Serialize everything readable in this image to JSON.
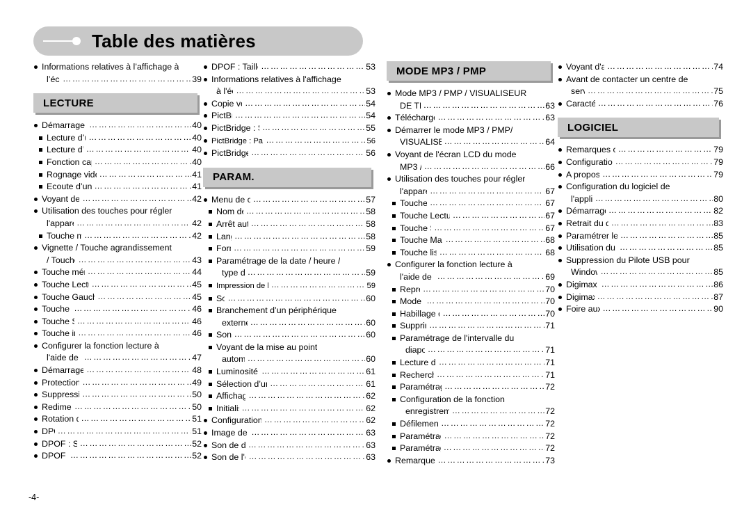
{
  "document": {
    "title": "Table des matières",
    "page_number": "-4-",
    "leader_dots": "……………………………………………………………………"
  },
  "theme": {
    "banner_bg": "#c8c8c8",
    "section_bg": "#c8c8c8",
    "section_shadow": "#9a9a9a",
    "text": "#000000",
    "page_bg": "#ffffff"
  },
  "columns": [
    {
      "name": "column-1",
      "blocks": [
        {
          "type": "entries",
          "items": [
            {
              "level": "main",
              "text": "Informations relatives à l’affichage à",
              "page": "",
              "leader": false
            },
            {
              "level": "cont",
              "text": "l’écran",
              "page": "39",
              "leader": true
            }
          ]
        },
        {
          "type": "section",
          "label": "LECTURE"
        },
        {
          "type": "entries",
          "items": [
            {
              "level": "main",
              "text": "Démarrage du mode lecture",
              "page": "40",
              "leader": true
            },
            {
              "level": "sub",
              "text": "Lecture d’une image fixe",
              "page": "40",
              "leader": true
            },
            {
              "level": "sub",
              "text": "Lecture d’un clip vidéo",
              "page": "40",
              "leader": true
            },
            {
              "level": "sub",
              "text": "Fonction capture de clip vidéo",
              "page": "40",
              "leader": true
            },
            {
              "level": "sub",
              "text": "Rognage vidéo sur l'appareil photo",
              "page": "41",
              "leader": true
            },
            {
              "level": "sub",
              "text": "Ecoute d’une voix enregistrée",
              "page": "41",
              "leader": true
            },
            {
              "level": "main",
              "text": "Voyant de l'écran LCD",
              "page": "42",
              "leader": true
            },
            {
              "level": "main",
              "text": "Utilisation des touches pour régler",
              "page": "",
              "leader": false
            },
            {
              "level": "cont",
              "text": "l'appareil photo",
              "page": "42",
              "leader": true
            },
            {
              "level": "sub",
              "text": "Touche mode lecture",
              "page": "42",
              "leader": true
            },
            {
              "level": "main",
              "text": "Vignette / Touche agrandissement",
              "page": "",
              "leader": false
            },
            {
              "level": "cont",
              "text": "/ Touche volume",
              "page": "43",
              "leader": true
            },
            {
              "level": "main",
              "text": "Touche mémo vocal / Haut",
              "page": "44",
              "leader": true
            },
            {
              "level": "main",
              "text": "Touche Lecture & Pause / Bas",
              "page": "45",
              "leader": true
            },
            {
              "level": "main",
              "text": "Touche Gauche / Droite / Menu / OK",
              "page": "45",
              "leader": true
            },
            {
              "level": "main",
              "text": "Touche E (Effet)",
              "page": "46",
              "leader": true
            },
            {
              "level": "main",
              "text": "Touche Supprimer",
              "page": "46",
              "leader": true
            },
            {
              "level": "main",
              "text": "Touche imprimante",
              "page": "46",
              "leader": true
            },
            {
              "level": "main",
              "text": "Configurer la fonction lecture à",
              "page": "",
              "leader": false
            },
            {
              "level": "cont",
              "text": "l'aide de l'écran LCD",
              "page": "47",
              "leader": true
            },
            {
              "level": "main",
              "text": "Démarrage du diaporama",
              "page": "48",
              "leader": true
            },
            {
              "level": "main",
              "text": "Protection des images",
              "page": "49",
              "leader": true
            },
            {
              "level": "main",
              "text": "Suppression d’images",
              "page": "50",
              "leader": true
            },
            {
              "level": "main",
              "text": "Redimensionner",
              "page": "50",
              "leader": true
            },
            {
              "level": "main",
              "text": "Rotation d’une image",
              "page": "51",
              "leader": true
            },
            {
              "level": "main",
              "text": "DPOF",
              "page": "51",
              "leader": true
            },
            {
              "level": "main",
              "text": "DPOF : STANDARD",
              "page": "52",
              "leader": true
            },
            {
              "level": "main",
              "text": "DPOF : Index",
              "page": "52",
              "leader": true
            }
          ]
        }
      ]
    },
    {
      "name": "column-2",
      "blocks": [
        {
          "type": "entries",
          "items": [
            {
              "level": "main",
              "text": "DPOF : Taille de l'impression",
              "page": "53",
              "leader": true
            },
            {
              "level": "main",
              "text": "Informations relatives à l'affichage",
              "page": "",
              "leader": false
            },
            {
              "level": "cont",
              "text": "à l'écran",
              "page": "53",
              "leader": true
            },
            {
              "level": "main",
              "text": "Copie vers carte",
              "page": "54",
              "leader": true
            },
            {
              "level": "main",
              "text": "PictBridge",
              "page": "54",
              "leader": true
            },
            {
              "level": "main",
              "text": "PictBridge : Sélection d’image",
              "page": "55",
              "leader": true
            },
            {
              "level": "main",
              "text": "PictBridge : Paramétrage impression",
              "page": "56",
              "leader": true,
              "narrow": true
            },
            {
              "level": "main",
              "text": "PictBridge : REMISE",
              "page": "56",
              "leader": true
            }
          ]
        },
        {
          "type": "section",
          "label": "PARAM."
        },
        {
          "type": "entries",
          "items": [
            {
              "level": "main",
              "text": "Menu de configuration",
              "page": "57",
              "leader": true
            },
            {
              "level": "sub",
              "text": "Nom de fichier",
              "page": "58",
              "leader": true
            },
            {
              "level": "sub",
              "text": "Arrêt automatique",
              "page": "58",
              "leader": true
            },
            {
              "level": "sub",
              "text": "Langue",
              "page": "58",
              "leader": true
            },
            {
              "level": "sub",
              "text": "Format",
              "page": "59",
              "leader": true
            },
            {
              "level": "sub",
              "text": "Paramétrage de la date / heure /",
              "page": "",
              "leader": false
            },
            {
              "level": "subcont",
              "text": "type de date",
              "page": "59",
              "leader": true
            },
            {
              "level": "sub",
              "text": "Impression de la date d’enregistrement",
              "page": "59",
              "leader": true,
              "narrow": true
            },
            {
              "level": "sub",
              "text": "Son",
              "page": "60",
              "leader": true
            },
            {
              "level": "sub",
              "text": "Branchement d’un périphérique",
              "page": "",
              "leader": false
            },
            {
              "level": "subcont",
              "text": "externe (USB)",
              "page": "60",
              "leader": true
            },
            {
              "level": "sub",
              "text": "Son AF",
              "page": "60",
              "leader": true
            },
            {
              "level": "sub",
              "text": "Voyant de la mise au point",
              "page": "",
              "leader": false
            },
            {
              "level": "subcont",
              "text": "automatique",
              "page": "60",
              "leader": true
            },
            {
              "level": "sub",
              "text": "Luminosité de l'écran LCD",
              "page": "61",
              "leader": true
            },
            {
              "level": "sub",
              "text": "Sélection d’un type de sortie vidéo",
              "page": "61",
              "leader": true
            },
            {
              "level": "sub",
              "text": "Affichage rapide",
              "page": "62",
              "leader": true
            },
            {
              "level": "sub",
              "text": "Initialisation",
              "page": "62",
              "leader": true
            },
            {
              "level": "main",
              "text": "Configuration du menu MYCAM",
              "page": "62",
              "leader": true
            },
            {
              "level": "main",
              "text": "Image de démarrage",
              "page": "63",
              "leader": true
            },
            {
              "level": "main",
              "text": "Son de démarrage",
              "page": "63",
              "leader": true
            },
            {
              "level": "main",
              "text": "Son de l'obturateur",
              "page": "63",
              "leader": true
            }
          ]
        }
      ]
    },
    {
      "name": "column-3",
      "blocks": [
        {
          "type": "section",
          "label": "MODE MP3 / PMP",
          "first": true
        },
        {
          "type": "entries",
          "items": [
            {
              "level": "main",
              "text": "Mode MP3 / PMP / VISUALISEUR",
              "page": "",
              "leader": false
            },
            {
              "level": "cont",
              "text": "DE TEXTE",
              "page": "63",
              "leader": true
            },
            {
              "level": "main",
              "text": "Télécharger des fichiers",
              "page": "63",
              "leader": true
            },
            {
              "level": "main",
              "text": "Démarrer le mode MP3 / PMP/",
              "page": "",
              "leader": false
            },
            {
              "level": "cont",
              "text": "VISUALISEUR DE TEXTE",
              "page": "64",
              "leader": true
            },
            {
              "level": "main",
              "text": "Voyant de l'écran LCD du mode",
              "page": "",
              "leader": false
            },
            {
              "level": "cont",
              "text": "MP3 / PMP",
              "page": "66",
              "leader": true
            },
            {
              "level": "main",
              "text": "Utilisation des touches pour régler",
              "page": "",
              "leader": false
            },
            {
              "level": "cont",
              "text": "l'appareil photo",
              "page": "67",
              "leader": true
            },
            {
              "level": "sub",
              "text": "Touche volume",
              "page": "67",
              "leader": true
            },
            {
              "level": "sub",
              "text": "Touche Lecture & Pause / Contrôle",
              "page": "67",
              "leader": true
            },
            {
              "level": "sub",
              "text": "Touche Supprimer",
              "page": "67",
              "leader": true
            },
            {
              "level": "sub",
              "text": "Touche Maintien / Egaliseur",
              "page": "68",
              "leader": true
            },
            {
              "level": "sub",
              "text": "Touche liste de lecture",
              "page": "68",
              "leader": true
            },
            {
              "level": "main",
              "text": "Configurer la fonction lecture à",
              "page": "",
              "leader": false
            },
            {
              "level": "cont",
              "text": "l'aide de l'écran LCD",
              "page": "69",
              "leader": true
            },
            {
              "level": "sub",
              "text": "Reprendre",
              "page": "70",
              "leader": true
            },
            {
              "level": "sub",
              "text": "Mode lecture",
              "page": "70",
              "leader": true
            },
            {
              "level": "sub",
              "text": "Habillage du lecteur MP3",
              "page": "70",
              "leader": true
            },
            {
              "level": "sub",
              "text": "Supprimer tout",
              "page": "71",
              "leader": true
            },
            {
              "level": "sub",
              "text": "Paramétrage de l'intervalle du",
              "page": "",
              "leader": false
            },
            {
              "level": "subcont",
              "text": "diaporama",
              "page": "71",
              "leader": true
            },
            {
              "level": "sub",
              "text": "Lecture du diaporama",
              "page": "71",
              "leader": true
            },
            {
              "level": "sub",
              "text": "Recherche de cadre",
              "page": "71",
              "leader": true
            },
            {
              "level": "sub",
              "text": "Paramétrage de l'affichage",
              "page": "72",
              "leader": true
            },
            {
              "level": "sub",
              "text": "Configuration de la fonction",
              "page": "",
              "leader": false
            },
            {
              "level": "subcont",
              "text": "enregistrement en mode MP3.",
              "page": "72",
              "leader": true
            },
            {
              "level": "sub",
              "text": "Défilement automatique",
              "page": "72",
              "leader": true
            },
            {
              "level": "sub",
              "text": "Paramétrage du fond MP3",
              "page": "72",
              "leader": true
            },
            {
              "level": "sub",
              "text": "Paramétrage de la langue",
              "page": "72",
              "leader": true
            },
            {
              "level": "main",
              "text": "Remarques importantes",
              "page": "73",
              "leader": true
            }
          ]
        }
      ]
    },
    {
      "name": "column-4",
      "blocks": [
        {
          "type": "entries",
          "items": [
            {
              "level": "main",
              "text": "Voyant d'avertissement",
              "page": "74",
              "leader": true
            },
            {
              "level": "main",
              "text": "Avant de contacter un centre de",
              "page": "",
              "leader": false
            },
            {
              "level": "cont",
              "text": "service",
              "page": "75",
              "leader": true
            },
            {
              "level": "main",
              "text": "Caractéristiques",
              "page": "76",
              "leader": true
            }
          ]
        },
        {
          "type": "section",
          "label": "LOGICIEL"
        },
        {
          "type": "entries",
          "items": [
            {
              "level": "main",
              "text": "Remarques concernant le logiciel",
              "page": "79",
              "leader": true
            },
            {
              "level": "main",
              "text": "Configuration système requise",
              "page": "79",
              "leader": true
            },
            {
              "level": "main",
              "text": "A propos du logiciel",
              "page": "79",
              "leader": true
            },
            {
              "level": "main",
              "text": "Configuration du logiciel de",
              "page": "",
              "leader": false
            },
            {
              "level": "cont",
              "text": "l'application",
              "page": "80",
              "leader": true
            },
            {
              "level": "main",
              "text": "Démarrage du mode PC",
              "page": "82",
              "leader": true
            },
            {
              "level": "main",
              "text": "Retrait du disque amovible",
              "page": "83",
              "leader": true
            },
            {
              "level": "main",
              "text": "Paramétrer le pilote USB pour MAC",
              "page": "85",
              "leader": true
            },
            {
              "level": "main",
              "text": "Utilisation du pilote USB pour MAC",
              "page": "85",
              "leader": true
            },
            {
              "level": "main",
              "text": "Suppression du Pilote USB pour",
              "page": "",
              "leader": false
            },
            {
              "level": "cont",
              "text": "Windows 98SE",
              "page": "85",
              "leader": true
            },
            {
              "level": "main",
              "text": "Digimax Converter",
              "page": "86",
              "leader": true
            },
            {
              "level": "main",
              "text": "Digimax Master",
              "page": "87",
              "leader": true
            },
            {
              "level": "main",
              "text": "Foire aux questions",
              "page": "90",
              "leader": true
            }
          ]
        }
      ]
    }
  ]
}
